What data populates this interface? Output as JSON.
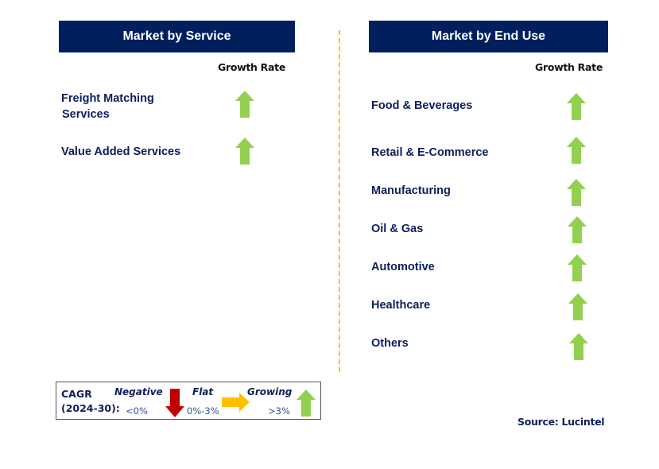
{
  "left_panel": {
    "title": "Market by Service",
    "growth_header": "Growth Rate",
    "items": [
      {
        "label_line1": "Freight Matching",
        "label_line2": "Services",
        "trend": "growing",
        "icon": "arrow-up-icon"
      },
      {
        "label_line1": "Value Added Services",
        "label_line2": "",
        "trend": "growing",
        "icon": "arrow-up-icon"
      }
    ]
  },
  "right_panel": {
    "title": "Market by End Use",
    "growth_header": "Growth Rate",
    "items": [
      {
        "label": "Food & Beverages",
        "trend": "growing",
        "icon": "arrow-up-icon"
      },
      {
        "label": "Retail & E-Commerce",
        "trend": "growing",
        "icon": "arrow-up-icon"
      },
      {
        "label": "Manufacturing",
        "trend": "growing",
        "icon": "arrow-up-icon"
      },
      {
        "label": "Oil & Gas",
        "trend": "growing",
        "icon": "arrow-up-icon"
      },
      {
        "label": "Automotive",
        "trend": "growing",
        "icon": "arrow-up-icon"
      },
      {
        "label": "Healthcare",
        "trend": "growing",
        "icon": "arrow-up-icon"
      },
      {
        "label": "Others",
        "trend": "growing",
        "icon": "arrow-up-icon"
      }
    ]
  },
  "legend": {
    "cagr_label_line1": "CAGR",
    "cagr_label_line2": "(2024-30):",
    "negative": {
      "label": "Negative",
      "range": "<0%",
      "icon": "arrow-down-icon",
      "color": "#c00000"
    },
    "flat": {
      "label": "Flat",
      "range": "0%-3%",
      "icon": "arrow-right-icon",
      "color": "#ffc000"
    },
    "growing": {
      "label": "Growing",
      "range": ">3%",
      "icon": "arrow-up-icon",
      "color": "#92d050"
    }
  },
  "colors": {
    "header_bg": "#001f5c",
    "label_text": "#0c1f5c",
    "divider": "#ffc000",
    "up_arrow": "#92d050"
  },
  "source": "Source: Lucintel"
}
